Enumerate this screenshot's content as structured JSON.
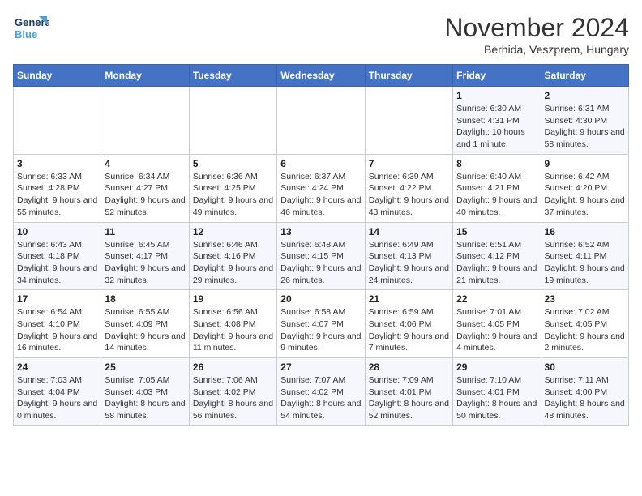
{
  "logo": {
    "line1": "General",
    "line2": "Blue"
  },
  "header": {
    "month": "November 2024",
    "location": "Berhida, Veszprem, Hungary"
  },
  "weekdays": [
    "Sunday",
    "Monday",
    "Tuesday",
    "Wednesday",
    "Thursday",
    "Friday",
    "Saturday"
  ],
  "weeks": [
    [
      {
        "day": "",
        "info": ""
      },
      {
        "day": "",
        "info": ""
      },
      {
        "day": "",
        "info": ""
      },
      {
        "day": "",
        "info": ""
      },
      {
        "day": "",
        "info": ""
      },
      {
        "day": "1",
        "info": "Sunrise: 6:30 AM\nSunset: 4:31 PM\nDaylight: 10 hours and 1 minute."
      },
      {
        "day": "2",
        "info": "Sunrise: 6:31 AM\nSunset: 4:30 PM\nDaylight: 9 hours and 58 minutes."
      }
    ],
    [
      {
        "day": "3",
        "info": "Sunrise: 6:33 AM\nSunset: 4:28 PM\nDaylight: 9 hours and 55 minutes."
      },
      {
        "day": "4",
        "info": "Sunrise: 6:34 AM\nSunset: 4:27 PM\nDaylight: 9 hours and 52 minutes."
      },
      {
        "day": "5",
        "info": "Sunrise: 6:36 AM\nSunset: 4:25 PM\nDaylight: 9 hours and 49 minutes."
      },
      {
        "day": "6",
        "info": "Sunrise: 6:37 AM\nSunset: 4:24 PM\nDaylight: 9 hours and 46 minutes."
      },
      {
        "day": "7",
        "info": "Sunrise: 6:39 AM\nSunset: 4:22 PM\nDaylight: 9 hours and 43 minutes."
      },
      {
        "day": "8",
        "info": "Sunrise: 6:40 AM\nSunset: 4:21 PM\nDaylight: 9 hours and 40 minutes."
      },
      {
        "day": "9",
        "info": "Sunrise: 6:42 AM\nSunset: 4:20 PM\nDaylight: 9 hours and 37 minutes."
      }
    ],
    [
      {
        "day": "10",
        "info": "Sunrise: 6:43 AM\nSunset: 4:18 PM\nDaylight: 9 hours and 34 minutes."
      },
      {
        "day": "11",
        "info": "Sunrise: 6:45 AM\nSunset: 4:17 PM\nDaylight: 9 hours and 32 minutes."
      },
      {
        "day": "12",
        "info": "Sunrise: 6:46 AM\nSunset: 4:16 PM\nDaylight: 9 hours and 29 minutes."
      },
      {
        "day": "13",
        "info": "Sunrise: 6:48 AM\nSunset: 4:15 PM\nDaylight: 9 hours and 26 minutes."
      },
      {
        "day": "14",
        "info": "Sunrise: 6:49 AM\nSunset: 4:13 PM\nDaylight: 9 hours and 24 minutes."
      },
      {
        "day": "15",
        "info": "Sunrise: 6:51 AM\nSunset: 4:12 PM\nDaylight: 9 hours and 21 minutes."
      },
      {
        "day": "16",
        "info": "Sunrise: 6:52 AM\nSunset: 4:11 PM\nDaylight: 9 hours and 19 minutes."
      }
    ],
    [
      {
        "day": "17",
        "info": "Sunrise: 6:54 AM\nSunset: 4:10 PM\nDaylight: 9 hours and 16 minutes."
      },
      {
        "day": "18",
        "info": "Sunrise: 6:55 AM\nSunset: 4:09 PM\nDaylight: 9 hours and 14 minutes."
      },
      {
        "day": "19",
        "info": "Sunrise: 6:56 AM\nSunset: 4:08 PM\nDaylight: 9 hours and 11 minutes."
      },
      {
        "day": "20",
        "info": "Sunrise: 6:58 AM\nSunset: 4:07 PM\nDaylight: 9 hours and 9 minutes."
      },
      {
        "day": "21",
        "info": "Sunrise: 6:59 AM\nSunset: 4:06 PM\nDaylight: 9 hours and 7 minutes."
      },
      {
        "day": "22",
        "info": "Sunrise: 7:01 AM\nSunset: 4:05 PM\nDaylight: 9 hours and 4 minutes."
      },
      {
        "day": "23",
        "info": "Sunrise: 7:02 AM\nSunset: 4:05 PM\nDaylight: 9 hours and 2 minutes."
      }
    ],
    [
      {
        "day": "24",
        "info": "Sunrise: 7:03 AM\nSunset: 4:04 PM\nDaylight: 9 hours and 0 minutes."
      },
      {
        "day": "25",
        "info": "Sunrise: 7:05 AM\nSunset: 4:03 PM\nDaylight: 8 hours and 58 minutes."
      },
      {
        "day": "26",
        "info": "Sunrise: 7:06 AM\nSunset: 4:02 PM\nDaylight: 8 hours and 56 minutes."
      },
      {
        "day": "27",
        "info": "Sunrise: 7:07 AM\nSunset: 4:02 PM\nDaylight: 8 hours and 54 minutes."
      },
      {
        "day": "28",
        "info": "Sunrise: 7:09 AM\nSunset: 4:01 PM\nDaylight: 8 hours and 52 minutes."
      },
      {
        "day": "29",
        "info": "Sunrise: 7:10 AM\nSunset: 4:01 PM\nDaylight: 8 hours and 50 minutes."
      },
      {
        "day": "30",
        "info": "Sunrise: 7:11 AM\nSunset: 4:00 PM\nDaylight: 8 hours and 48 minutes."
      }
    ]
  ]
}
